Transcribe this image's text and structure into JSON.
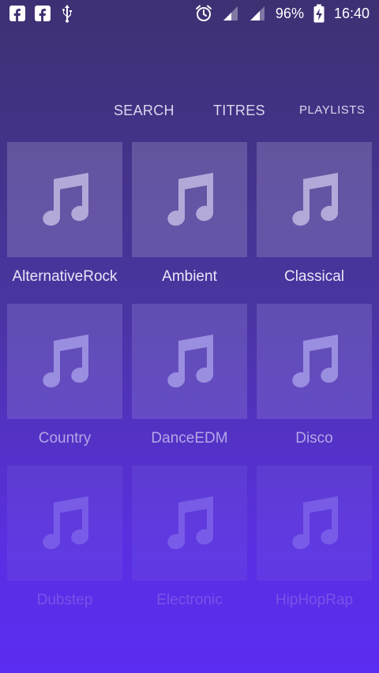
{
  "status_bar": {
    "left_icons": [
      "facebook-icon",
      "facebook-icon",
      "usb-icon"
    ],
    "battery": "96%",
    "time": "16:40"
  },
  "tabs": [
    {
      "label": "SEARCH"
    },
    {
      "label": "TITRES"
    },
    {
      "label": "PLAYLISTS"
    }
  ],
  "genres": [
    {
      "label": "AlternativeRock",
      "icon": "music-note-icon"
    },
    {
      "label": "Ambient",
      "icon": "music-note-icon"
    },
    {
      "label": "Classical",
      "icon": "music-note-icon"
    },
    {
      "label": "Country",
      "icon": "music-note-icon"
    },
    {
      "label": "DanceEDM",
      "icon": "music-note-icon"
    },
    {
      "label": "Disco",
      "icon": "music-note-icon"
    },
    {
      "label": "Dubstep",
      "icon": "music-note-icon"
    },
    {
      "label": "Electronic",
      "icon": "music-note-icon"
    },
    {
      "label": "HipHopRap",
      "icon": "music-note-icon"
    }
  ]
}
